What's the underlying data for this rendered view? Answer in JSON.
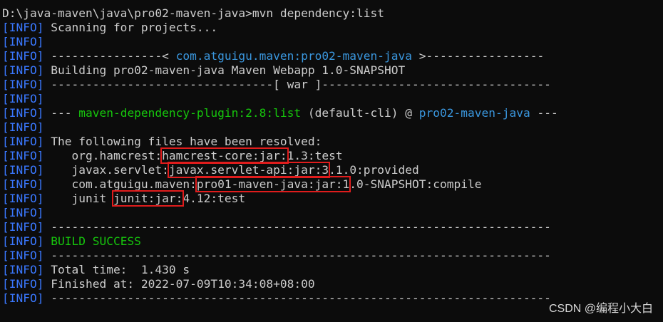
{
  "terminal": {
    "prompt": "D:\\java-maven\\java\\pro02-maven-java>",
    "command": "mvn dependency:list",
    "info_tag": "[INFO]",
    "lines": {
      "scanning": " Scanning for projects...",
      "sep1_left": " ----------------< ",
      "artifact": "com.atguigu.maven:pro02-maven-java",
      "sep1_right": " >-----------------",
      "building": " Building pro02-maven-java Maven Webapp 1.0-SNAPSHOT",
      "sep2": " --------------------------------[ war ]---------------------------------",
      "plugin_prefix": " --- ",
      "plugin": "maven-dependency-plugin:2.8:list",
      "plugin_mid": " (default-cli) @ ",
      "plugin_project": "pro02-maven-java",
      "plugin_suffix": " ---",
      "resolved": " The following files have been resolved:",
      "dep1_pre": "    org.hamcrest:",
      "dep1_hl": "hamcrest-core:jar:",
      "dep1_post": "1.3:test",
      "dep2_pre": "    javax.servlet:",
      "dep2_hl": "javax.servlet-api:jar:3",
      "dep2_post": ".1.0:provided",
      "dep3_pre": "    com.atguigu.maven:",
      "dep3_hl": "pro01-maven-java:jar:1",
      "dep3_post": ".0-SNAPSHOT:compile",
      "dep4_pre": "    junit ",
      "dep4_hl": "junit:jar:",
      "dep4_post": "4.12:test",
      "sep_long": " ------------------------------------------------------------------------",
      "build_success": "BUILD SUCCESS",
      "total_time": " Total time:  1.430 s",
      "finished_at": " Finished at: 2022-07-09T10:34:08+08:00"
    }
  },
  "watermark": "CSDN @编程小大白",
  "colors": {
    "background": "#0c0c0c",
    "text": "#cccccc",
    "info_tag": "#3a78ff",
    "green": "#16c60c",
    "cyan": "#3a96dd",
    "highlight_box": "#e01c1c"
  }
}
